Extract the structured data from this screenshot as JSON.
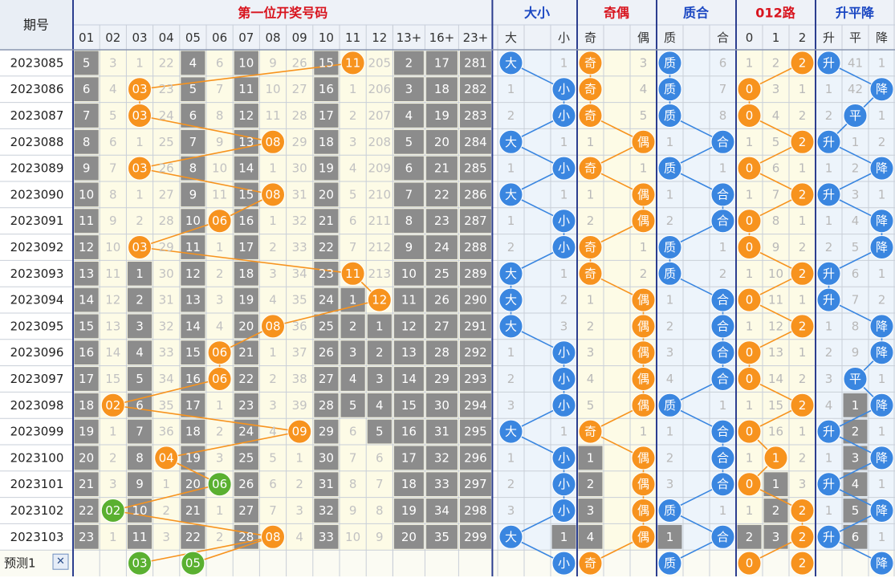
{
  "header": {
    "period_label": "期号",
    "first_digit_title": "第一位开奖号码",
    "size_title": "大小",
    "parity_title": "奇偶",
    "prime_title": "质合",
    "road_title": "012路",
    "trend_title": "升平降"
  },
  "columns": {
    "numbers": [
      "01",
      "02",
      "03",
      "04",
      "05",
      "06",
      "07",
      "08",
      "09",
      "10",
      "11",
      "12"
    ],
    "sums": [
      "13+",
      "16+",
      "23+"
    ],
    "size": [
      "大",
      "小"
    ],
    "parity": [
      "奇",
      "偶"
    ],
    "prime": [
      "质",
      "合"
    ],
    "road": [
      "0",
      "1",
      "2"
    ],
    "trend": [
      "升",
      "平",
      "降"
    ]
  },
  "chart_data": {
    "type": "table",
    "title": "第一位开奖号码",
    "periods": [
      "2023085",
      "2023086",
      "2023087",
      "2023088",
      "2023089",
      "2023090",
      "2023091",
      "2023092",
      "2023093",
      "2023094",
      "2023095",
      "2023096",
      "2023097",
      "2023098",
      "2023099",
      "2023100",
      "2023101",
      "2023102",
      "2023103"
    ],
    "first_number": [
      11,
      3,
      3,
      8,
      3,
      8,
      6,
      3,
      11,
      12,
      8,
      6,
      6,
      2,
      9,
      4,
      6,
      2,
      8
    ],
    "miss_grid": [
      [
        5,
        3,
        1,
        22,
        4,
        6,
        10,
        9,
        26,
        15,
        0,
        205
      ],
      [
        6,
        4,
        0,
        23,
        5,
        7,
        11,
        10,
        27,
        16,
        1,
        206
      ],
      [
        7,
        5,
        0,
        24,
        6,
        8,
        12,
        11,
        28,
        17,
        2,
        207
      ],
      [
        8,
        6,
        1,
        25,
        7,
        9,
        13,
        0,
        29,
        18,
        3,
        208
      ],
      [
        9,
        7,
        0,
        26,
        8,
        10,
        14,
        1,
        30,
        19,
        4,
        209
      ],
      [
        10,
        8,
        1,
        27,
        9,
        11,
        15,
        0,
        31,
        20,
        5,
        210
      ],
      [
        11,
        9,
        2,
        28,
        10,
        0,
        16,
        1,
        32,
        21,
        6,
        211
      ],
      [
        12,
        10,
        0,
        29,
        11,
        1,
        17,
        2,
        33,
        22,
        7,
        212
      ],
      [
        13,
        11,
        1,
        30,
        12,
        2,
        18,
        3,
        34,
        23,
        0,
        213
      ],
      [
        14,
        12,
        2,
        31,
        13,
        3,
        19,
        4,
        35,
        24,
        1,
        0
      ],
      [
        15,
        13,
        3,
        32,
        14,
        4,
        20,
        0,
        36,
        25,
        2,
        1
      ],
      [
        16,
        14,
        4,
        33,
        15,
        0,
        21,
        1,
        37,
        26,
        3,
        2
      ],
      [
        17,
        15,
        5,
        34,
        16,
        0,
        22,
        2,
        38,
        27,
        4,
        3
      ],
      [
        18,
        0,
        6,
        35,
        17,
        1,
        23,
        3,
        39,
        28,
        5,
        4
      ],
      [
        19,
        1,
        7,
        36,
        18,
        2,
        24,
        4,
        0,
        29,
        6,
        5
      ],
      [
        20,
        2,
        8,
        0,
        19,
        3,
        25,
        5,
        1,
        30,
        7,
        6
      ],
      [
        21,
        3,
        9,
        1,
        20,
        0,
        26,
        6,
        2,
        31,
        8,
        7
      ],
      [
        22,
        0,
        10,
        2,
        21,
        1,
        27,
        7,
        3,
        32,
        9,
        8
      ],
      [
        23,
        1,
        11,
        3,
        22,
        2,
        28,
        0,
        4,
        33,
        10,
        9
      ]
    ],
    "sum_grid": [
      [
        2,
        17,
        281
      ],
      [
        3,
        18,
        282
      ],
      [
        4,
        19,
        283
      ],
      [
        5,
        20,
        284
      ],
      [
        6,
        21,
        285
      ],
      [
        7,
        22,
        286
      ],
      [
        8,
        23,
        287
      ],
      [
        9,
        24,
        288
      ],
      [
        10,
        25,
        289
      ],
      [
        11,
        26,
        290
      ],
      [
        12,
        27,
        291
      ],
      [
        13,
        28,
        292
      ],
      [
        14,
        29,
        293
      ],
      [
        15,
        30,
        294
      ],
      [
        16,
        31,
        295
      ],
      [
        17,
        32,
        296
      ],
      [
        18,
        33,
        297
      ],
      [
        19,
        34,
        298
      ],
      [
        20,
        35,
        299
      ]
    ],
    "size_grid": [
      [
        0,
        1
      ],
      [
        1,
        0
      ],
      [
        2,
        0
      ],
      [
        0,
        1
      ],
      [
        1,
        0
      ],
      [
        0,
        1
      ],
      [
        1,
        0
      ],
      [
        2,
        0
      ],
      [
        0,
        1
      ],
      [
        0,
        2
      ],
      [
        0,
        3
      ],
      [
        1,
        0
      ],
      [
        2,
        0
      ],
      [
        3,
        0
      ],
      [
        0,
        1
      ],
      [
        1,
        0
      ],
      [
        2,
        0
      ],
      [
        3,
        0
      ],
      [
        0,
        1
      ]
    ],
    "parity_grid": [
      [
        0,
        3
      ],
      [
        0,
        4
      ],
      [
        0,
        5
      ],
      [
        1,
        0
      ],
      [
        0,
        1
      ],
      [
        1,
        0
      ],
      [
        2,
        0
      ],
      [
        0,
        1
      ],
      [
        0,
        2
      ],
      [
        1,
        0
      ],
      [
        2,
        0
      ],
      [
        3,
        0
      ],
      [
        4,
        0
      ],
      [
        5,
        0
      ],
      [
        0,
        1
      ],
      [
        1,
        0
      ],
      [
        2,
        0
      ],
      [
        3,
        0
      ],
      [
        4,
        0
      ]
    ],
    "prime_grid": [
      [
        0,
        6
      ],
      [
        0,
        7
      ],
      [
        0,
        8
      ],
      [
        1,
        0
      ],
      [
        0,
        1
      ],
      [
        1,
        0
      ],
      [
        2,
        0
      ],
      [
        0,
        1
      ],
      [
        0,
        2
      ],
      [
        1,
        0
      ],
      [
        2,
        0
      ],
      [
        3,
        0
      ],
      [
        4,
        0
      ],
      [
        0,
        1
      ],
      [
        1,
        0
      ],
      [
        2,
        0
      ],
      [
        3,
        0
      ],
      [
        0,
        1
      ],
      [
        1,
        0
      ]
    ],
    "road_grid": [
      [
        1,
        2,
        0
      ],
      [
        0,
        3,
        1
      ],
      [
        0,
        4,
        2
      ],
      [
        1,
        5,
        0
      ],
      [
        0,
        6,
        1
      ],
      [
        1,
        7,
        0
      ],
      [
        0,
        8,
        1
      ],
      [
        0,
        9,
        2
      ],
      [
        1,
        10,
        0
      ],
      [
        0,
        11,
        1
      ],
      [
        1,
        12,
        0
      ],
      [
        0,
        13,
        1
      ],
      [
        0,
        14,
        2
      ],
      [
        1,
        15,
        0
      ],
      [
        0,
        16,
        1
      ],
      [
        1,
        0,
        2
      ],
      [
        0,
        1,
        3
      ],
      [
        1,
        2,
        0
      ],
      [
        2,
        3,
        0
      ]
    ],
    "trend_grid": [
      [
        0,
        41,
        1
      ],
      [
        1,
        42,
        0
      ],
      [
        2,
        0,
        1
      ],
      [
        0,
        1,
        2
      ],
      [
        1,
        2,
        0
      ],
      [
        0,
        3,
        1
      ],
      [
        1,
        4,
        0
      ],
      [
        2,
        5,
        0
      ],
      [
        0,
        6,
        1
      ],
      [
        0,
        7,
        2
      ],
      [
        1,
        8,
        0
      ],
      [
        2,
        9,
        0
      ],
      [
        3,
        0,
        1
      ],
      [
        4,
        1,
        0
      ],
      [
        0,
        2,
        1
      ],
      [
        1,
        3,
        0
      ],
      [
        0,
        4,
        1
      ],
      [
        1,
        5,
        0
      ],
      [
        0,
        6,
        1
      ]
    ],
    "size_result": [
      "大",
      "小",
      "小",
      "大",
      "小",
      "大",
      "小",
      "小",
      "大",
      "大",
      "大",
      "小",
      "小",
      "小",
      "大",
      "小",
      "小",
      "小",
      "大"
    ],
    "parity_result": [
      "奇",
      "奇",
      "奇",
      "偶",
      "奇",
      "偶",
      "偶",
      "奇",
      "奇",
      "偶",
      "偶",
      "偶",
      "偶",
      "偶",
      "奇",
      "偶",
      "偶",
      "偶",
      "偶"
    ],
    "prime_result": [
      "质",
      "质",
      "质",
      "合",
      "质",
      "合",
      "合",
      "质",
      "质",
      "合",
      "合",
      "合",
      "合",
      "质",
      "合",
      "合",
      "合",
      "质",
      "合"
    ],
    "road_result": [
      "2",
      "0",
      "0",
      "2",
      "0",
      "2",
      "0",
      "0",
      "2",
      "0",
      "2",
      "0",
      "0",
      "2",
      "0",
      "1",
      "0",
      "2",
      "2"
    ],
    "trend_result": [
      "升",
      "降",
      "平",
      "升",
      "降",
      "升",
      "降",
      "降",
      "升",
      "升",
      "降",
      "降",
      "平",
      "降",
      "升",
      "降",
      "升",
      "降",
      "升"
    ]
  },
  "prediction": {
    "label": "预测1",
    "close_symbol": "✕",
    "numbers": [
      "03",
      "05"
    ],
    "number_cols": [
      2,
      4
    ],
    "size": "小",
    "parity": "奇",
    "prime": "质",
    "road": "0",
    "road2": "2",
    "trend": "降"
  },
  "colors": {
    "orange": "#f7931e",
    "green": "#5ab030",
    "blue": "#3a86e0",
    "gray_cell": "#8c8c8c",
    "yellow_bg": "#fdfbe6",
    "blue_bg": "#edf4fb",
    "title_red": "#d8141e",
    "title_blue": "#1a47c2"
  }
}
